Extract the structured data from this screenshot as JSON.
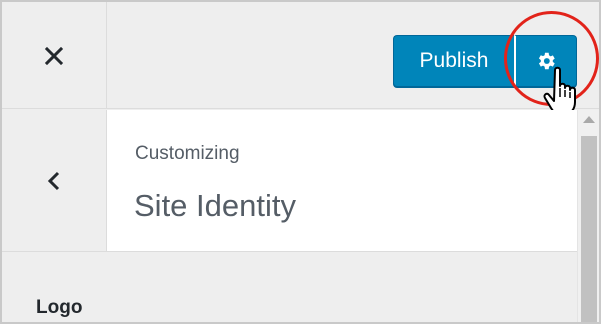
{
  "header": {
    "close_icon": "close-icon",
    "publish_label": "Publish",
    "settings_icon": "gear-icon"
  },
  "section": {
    "back_icon": "chevron-left-icon",
    "breadcrumb_label": "Customizing",
    "title": "Site Identity"
  },
  "content": {
    "logo_label": "Logo"
  },
  "colors": {
    "accent": "#0085ba",
    "accent_border": "#006799",
    "highlight_circle": "#e2231a",
    "panel_bg": "#eeeeee",
    "text": "#555d66"
  }
}
